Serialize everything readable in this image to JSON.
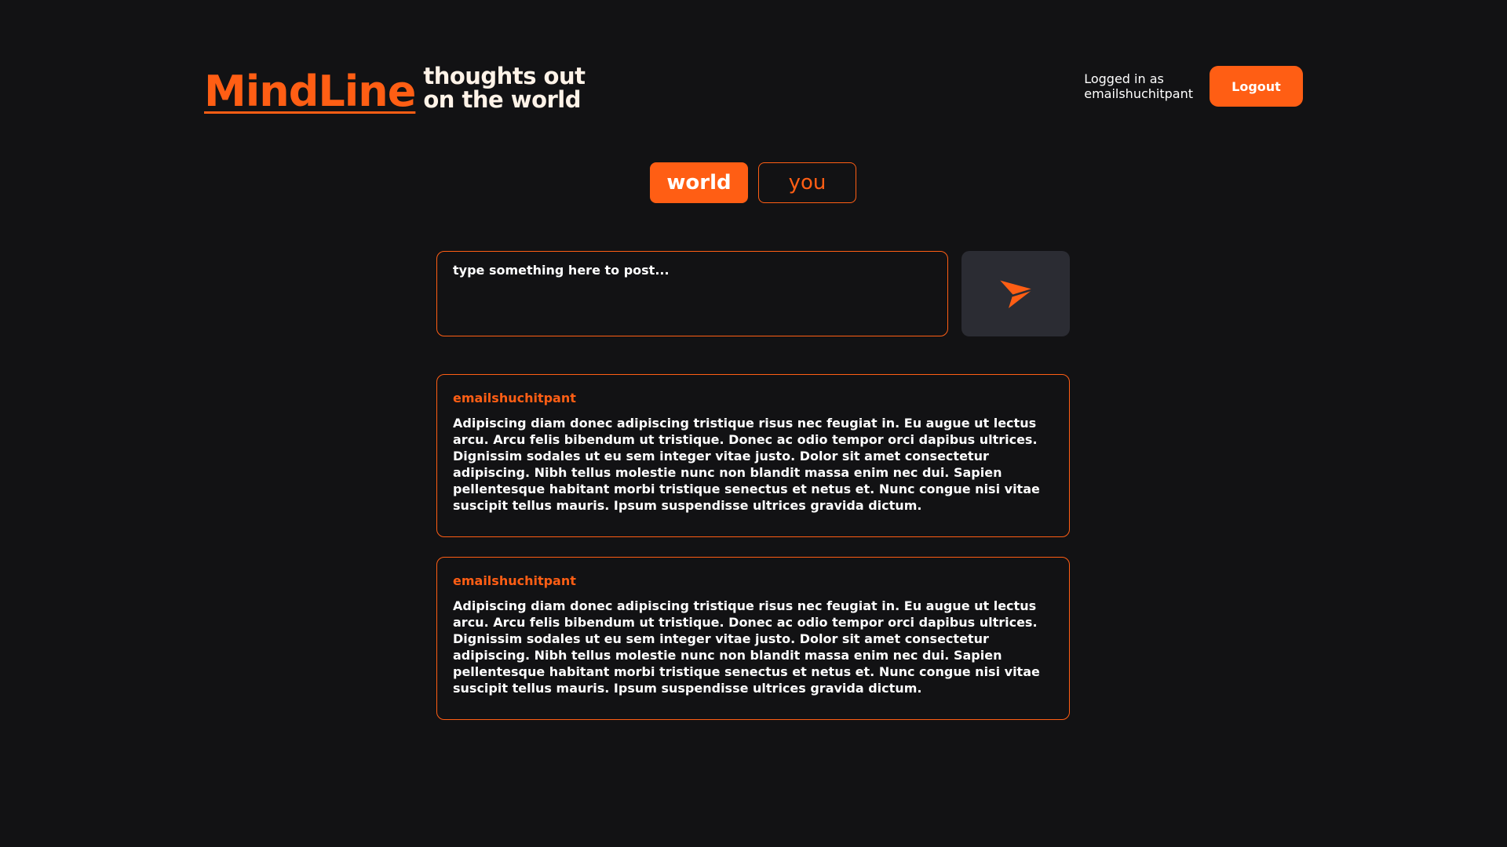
{
  "header": {
    "logo": "MindLine",
    "tagline_line1": "thoughts out",
    "tagline_line2": "on the world",
    "login_label": "Logged in as",
    "username": "emailshuchitpant",
    "logout_label": "Logout"
  },
  "tabs": [
    {
      "label": "world",
      "active": true
    },
    {
      "label": "you",
      "active": false
    }
  ],
  "composer": {
    "placeholder": "type something here to post...",
    "send_icon": "send-icon"
  },
  "posts": [
    {
      "author": "emailshuchitpant",
      "body": "Adipiscing diam donec adipiscing tristique risus nec feugiat in. Eu augue ut lectus arcu. Arcu felis bibendum ut tristique. Donec ac odio tempor orci dapibus ultrices. Dignissim sodales ut eu sem integer vitae justo. Dolor sit amet consectetur adipiscing. Nibh tellus molestie nunc non blandit massa enim nec dui. Sapien pellentesque habitant morbi tristique senectus et netus et. Nunc congue nisi vitae suscipit tellus mauris. Ipsum suspendisse ultrices gravida dictum."
    },
    {
      "author": "emailshuchitpant",
      "body": "Adipiscing diam donec adipiscing tristique risus nec feugiat in. Eu augue ut lectus arcu. Arcu felis bibendum ut tristique. Donec ac odio tempor orci dapibus ultrices. Dignissim sodales ut eu sem integer vitae justo. Dolor sit amet consectetur adipiscing. Nibh tellus molestie nunc non blandit massa enim nec dui. Sapien pellentesque habitant morbi tristique senectus et netus et. Nunc congue nisi vitae suscipit tellus mauris. Ipsum suspendisse ultrices gravida dictum."
    }
  ],
  "colors": {
    "accent": "#ff5e14",
    "background": "#121214",
    "send_button_bg": "#2b2c33"
  }
}
